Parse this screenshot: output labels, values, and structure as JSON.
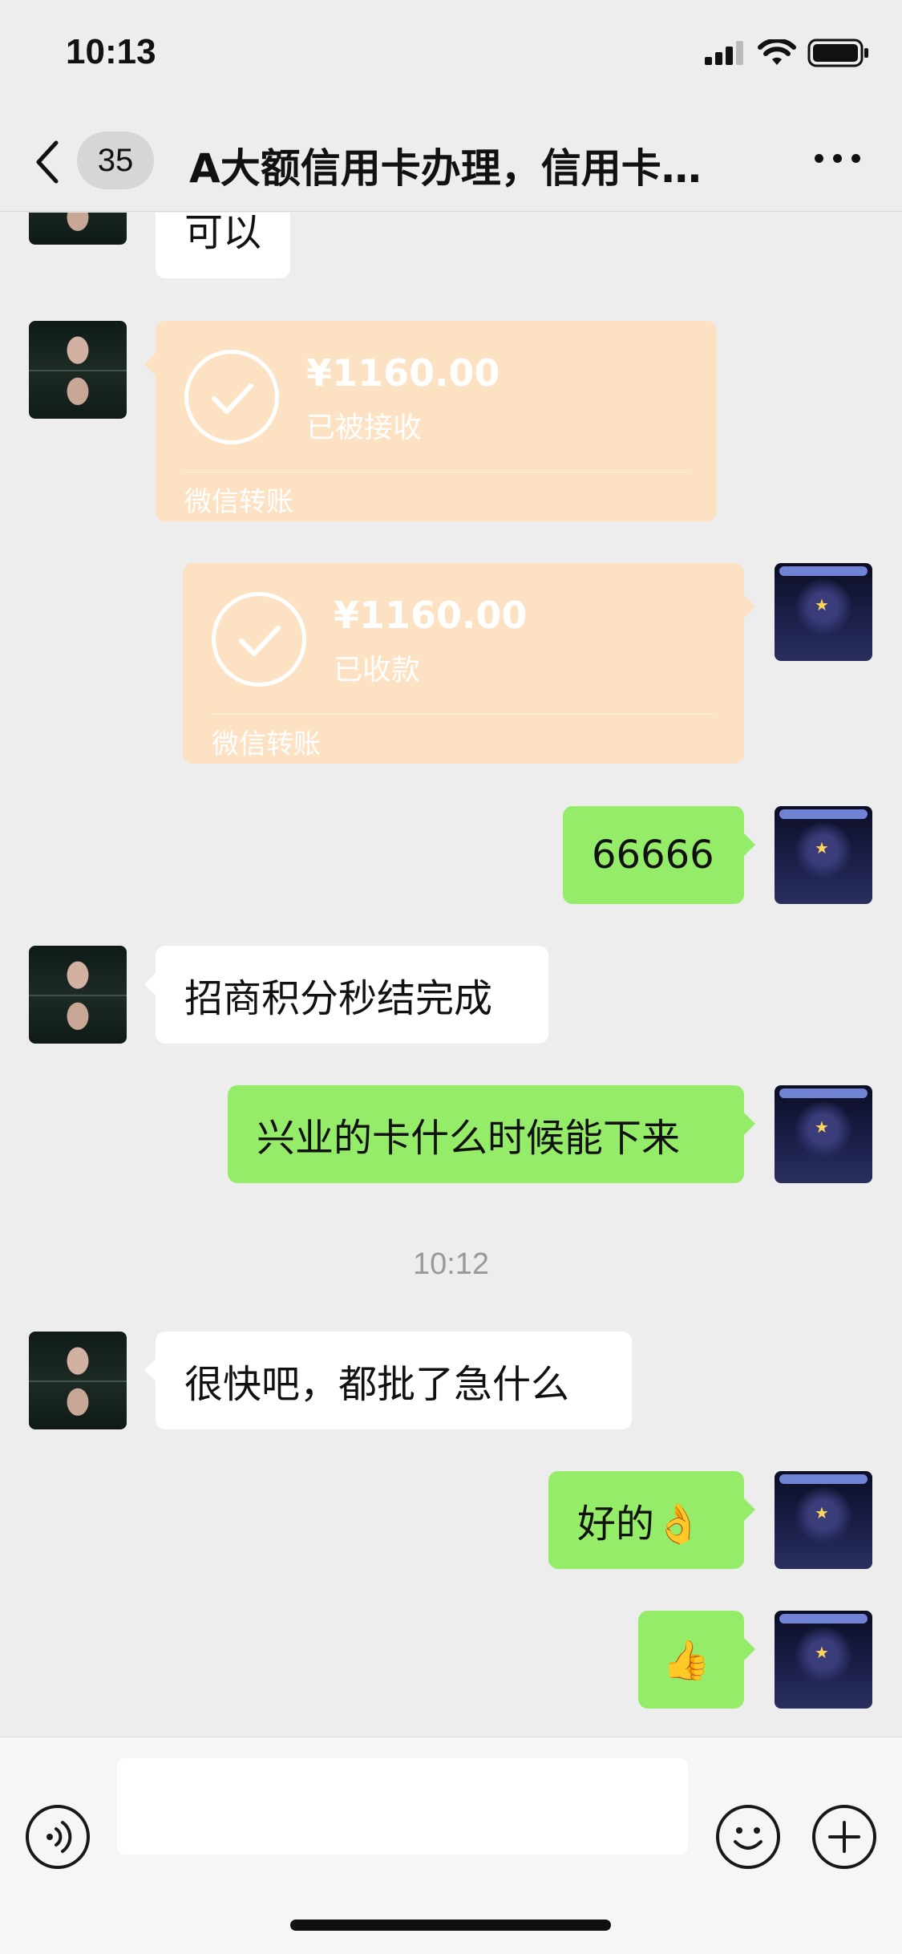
{
  "status_bar": {
    "time": "10:13",
    "icons": [
      "signal-icon",
      "wifi-icon",
      "battery-icon"
    ]
  },
  "nav": {
    "back_icon": "chevron-left-icon",
    "unread_count": "35",
    "title": "A大额信用卡办理，信用卡…",
    "more_icon": "more-dots-icon"
  },
  "messages": [
    {
      "side": "left",
      "type": "text",
      "text": "可以"
    },
    {
      "side": "left",
      "type": "transfer",
      "amount": "¥1160.00",
      "status": "已被接收",
      "brand": "微信转账"
    },
    {
      "side": "right",
      "type": "transfer",
      "amount": "¥1160.00",
      "status": "已收款",
      "brand": "微信转账"
    },
    {
      "side": "right",
      "type": "text",
      "text": "66666"
    },
    {
      "side": "left",
      "type": "text",
      "text": "招商积分秒结完成"
    },
    {
      "side": "right",
      "type": "text",
      "text": "兴业的卡什么时候能下来"
    },
    {
      "type": "timestamp",
      "text": "10:12"
    },
    {
      "side": "left",
      "type": "text",
      "text": "很快吧，都批了急什么"
    },
    {
      "side": "right",
      "type": "text",
      "text": "好的👌"
    },
    {
      "side": "right",
      "type": "text",
      "text": "👍"
    }
  ],
  "input_bar": {
    "voice_icon": "voice-icon",
    "emoji_icon": "emoji-icon",
    "plus_icon": "plus-icon",
    "placeholder": ""
  },
  "colors": {
    "background": "#ededed",
    "bubble_self": "#95ec69",
    "bubble_friend": "#ffffff",
    "transfer": "#fde1c3"
  }
}
